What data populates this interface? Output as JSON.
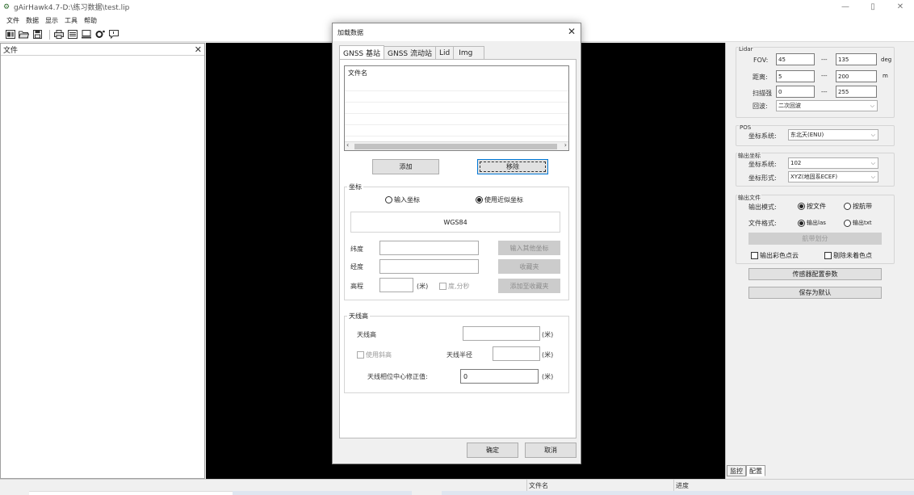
{
  "window": {
    "title": "gAirHawk4.7-D:\\练习数据\\test.lip",
    "minimize": "—",
    "maximize": "▯",
    "close": "✕"
  },
  "menu": [
    "文件",
    "数据",
    "显示",
    "工具",
    "帮助"
  ],
  "toolbar_icons": [
    "layout-icon",
    "open-folder-icon",
    "save-icon",
    "print-icon",
    "list-icon",
    "monitor-icon",
    "settings-icon",
    "comment-icon"
  ],
  "file_panel": {
    "title": "文件",
    "close": "✕"
  },
  "dialog": {
    "title": "加载数据",
    "close": "✕",
    "tabs": [
      "GNSS 基站",
      "GNSS 流动站",
      "Lid",
      "Img"
    ],
    "file_list_header": "文件名",
    "add_label": "添加",
    "remove_label": "移除",
    "coord_group_title": "坐标",
    "radio_input_coord": "输入坐标",
    "radio_use_approx": "使用近似坐标",
    "datum": "WGS84",
    "lat_label": "纬度",
    "lon_label": "经度",
    "height_label": "高程",
    "height_unit": "(米)",
    "dms_label": "度,分秒",
    "input_other_coord": "输入其他坐标",
    "favorites": "收藏夹",
    "add_to_favorites": "添加至收藏夹",
    "antenna_group_title": "天线高",
    "antenna_height_label": "天线高",
    "antenna_unit": "(米)",
    "use_slant_label": "使用斜高",
    "antenna_radius_label": "天线半径",
    "phase_center_label": "天线相位中心修正值:",
    "phase_center_value": "0",
    "ok_label": "确定",
    "cancel_label": "取消"
  },
  "right_panel": {
    "lidar_title": "Lidar",
    "fov_label": "FOV:",
    "fov_min": "45",
    "fov_max": "135",
    "fov_unit": "deg",
    "range_label": "距离:",
    "range_min": "5",
    "range_max": "200",
    "range_unit": "m",
    "scan_label": "扫描强",
    "scan_min": "0",
    "scan_max": "255",
    "echo_label": "回波:",
    "echo_value": "二次回波",
    "dash": "---",
    "pos_title": "POS",
    "pos_coord_label": "坐标系统:",
    "pos_coord_value": "东北天(ENU)",
    "out_coord_title": "输出坐标",
    "out_coord_label": "坐标系统:",
    "out_coord_value": "102",
    "out_form_label": "坐标形式:",
    "out_form_value": "XYZ(地固系ECEF)",
    "out_file_title": "输出文件",
    "out_mode_label": "输出模式:",
    "out_mode_file": "按文件",
    "out_mode_strip": "按航带",
    "file_format_label": "文件格式:",
    "fmt_las": "输出las",
    "fmt_txt": "输出txt",
    "strip_split": "航带划分",
    "color_cloud": "输出彩色点云",
    "remove_uncolored": "剔除未着色点",
    "sensor_config": "传感器配置参数",
    "save_default": "保存为默认"
  },
  "bottom_tabs": [
    "监控",
    "配置"
  ],
  "status": {
    "filename_col": "文件名",
    "progress_col": "进度"
  }
}
